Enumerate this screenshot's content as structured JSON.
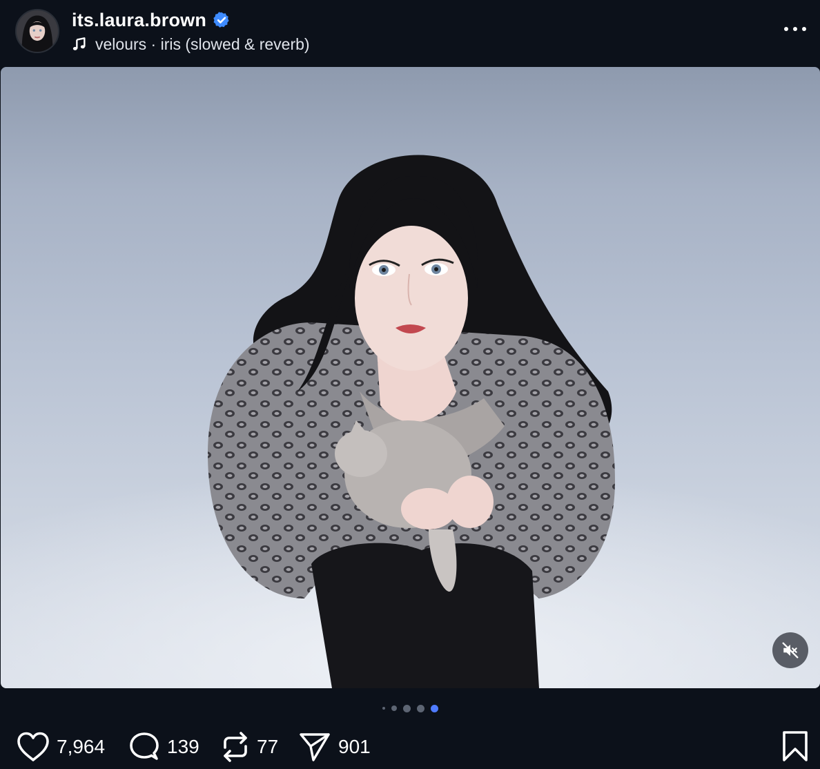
{
  "post": {
    "username": "its.laura.brown",
    "verified": true,
    "audio": "velours · iris (slowed & reverb)",
    "icons": {
      "avatar": "profile-avatar",
      "verified": "verified-badge-icon",
      "audio": "music-note-icon",
      "more": "more-options-icon",
      "mute": "muted-speaker-icon"
    },
    "carousel": {
      "total_dots": 5,
      "active_index": 5
    },
    "actions": {
      "likes": "7,964",
      "comments": "139",
      "reposts": "77",
      "shares": "901"
    }
  },
  "colors": {
    "background": "#0c111a",
    "verified_blue": "#3e8bff",
    "active_dot": "#4f7bff",
    "text": "#ffffff"
  }
}
